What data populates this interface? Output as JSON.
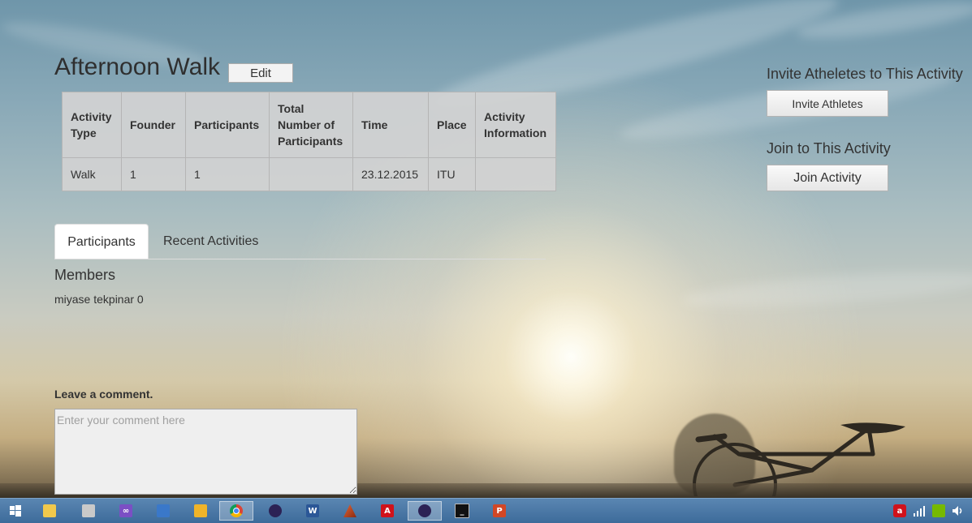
{
  "activity": {
    "title": "Afternoon Walk",
    "edit_label": "Edit"
  },
  "table": {
    "headers": [
      "Activity Type",
      "Founder",
      "Participants",
      "Total Number of Participants",
      "Time",
      "Place",
      "Activity Information"
    ],
    "row": [
      "Walk",
      "1",
      "1",
      "",
      "23.12.2015",
      "ITU",
      ""
    ]
  },
  "tabs": [
    {
      "label": "Participants",
      "active": true
    },
    {
      "label": "Recent Activities",
      "active": false
    }
  ],
  "members": {
    "heading": "Members",
    "items": [
      "miyase tekpinar 0"
    ]
  },
  "comment": {
    "label": "Leave a comment.",
    "placeholder": "Enter your comment here"
  },
  "sidebar": {
    "invite_heading": "Invite Atheletes to This Activity",
    "invite_button": "Invite Athletes",
    "join_heading": "Join to This Activity",
    "join_button": "Join Activity"
  },
  "taskbar": {
    "items": [
      {
        "name": "start-icon",
        "color": "#ffffff"
      },
      {
        "name": "file-explorer-icon",
        "color": "#f2c94c"
      },
      {
        "name": "tools-icon",
        "color": "#d9d9d9"
      },
      {
        "name": "visual-studio-icon",
        "color": "#7b4fc4"
      },
      {
        "name": "remote-desktop-icon",
        "color": "#3a78c9"
      },
      {
        "name": "network-folder-icon",
        "color": "#f0b429"
      },
      {
        "name": "chrome-icon",
        "color": "#db4437"
      },
      {
        "name": "eclipse-icon",
        "color": "#2c2255"
      },
      {
        "name": "word-icon",
        "color": "#2b5797"
      },
      {
        "name": "matlab-icon",
        "color": "#e16737"
      },
      {
        "name": "acrobat-icon",
        "color": "#d0121b"
      },
      {
        "name": "eclipse-2-icon",
        "color": "#2c2255"
      },
      {
        "name": "command-prompt-icon",
        "color": "#111111"
      },
      {
        "name": "powerpoint-icon",
        "color": "#d24726"
      }
    ]
  }
}
